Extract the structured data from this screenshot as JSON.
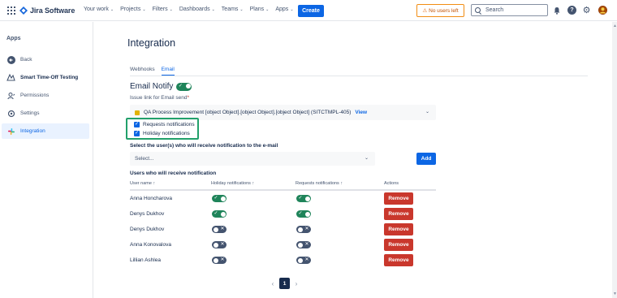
{
  "topnav": {
    "app_name": "Jira Software",
    "items": [
      {
        "label": "Your work"
      },
      {
        "label": "Projects"
      },
      {
        "label": "Filters"
      },
      {
        "label": "Dashboards"
      },
      {
        "label": "Teams"
      },
      {
        "label": "Plans"
      },
      {
        "label": "Apps"
      }
    ],
    "create_label": "Create",
    "warning_label": "No users left",
    "search_placeholder": "Search",
    "help_glyph": "?"
  },
  "sidebar": {
    "title": "Apps",
    "items": [
      {
        "label": "Back",
        "icon": "back-arrow-icon"
      },
      {
        "label": "Smart Time-Off Testing",
        "icon": "app-logo-icon"
      },
      {
        "label": "Permissions",
        "icon": "permissions-icon"
      },
      {
        "label": "Settings",
        "icon": "settings-icon"
      },
      {
        "label": "Integration",
        "icon": "slack-icon"
      }
    ]
  },
  "main": {
    "title": "Integration",
    "tabs": [
      {
        "label": "Webhooks"
      },
      {
        "label": "Email"
      }
    ],
    "email_notify_label": "Email Notify",
    "email_notify_enabled": true,
    "issue_label": "Issue link for Email send",
    "required_mark": "*",
    "issue_value": "QA Process Improvement [object Object].[object Object].[object Object] (SITCTMPL-405)",
    "issue_view_label": "View",
    "checkboxes": [
      {
        "label": "Requests notifications",
        "checked": true
      },
      {
        "label": "Holiday notifications",
        "checked": true
      }
    ],
    "select_users_label": "Select the user(s) who will receive notification to the e-mail",
    "select_placeholder": "Select...",
    "add_label": "Add",
    "users_title": "Users who will receive notification",
    "table": {
      "columns": [
        "User name",
        "Holiday notifications",
        "Requests notifications",
        "Actions"
      ],
      "sort_glyph": "↑",
      "rows": [
        {
          "name": "Anna Honcharova",
          "holiday": true,
          "requests": true,
          "action": "Remove"
        },
        {
          "name": "Denys Dukhov",
          "holiday": true,
          "requests": true,
          "action": "Remove"
        },
        {
          "name": "Denys Dukhov",
          "holiday": false,
          "requests": false,
          "action": "Remove"
        },
        {
          "name": "Anna Konovalova",
          "holiday": false,
          "requests": false,
          "action": "Remove"
        },
        {
          "name": "Lillian Ashlea",
          "holiday": false,
          "requests": false,
          "action": "Remove"
        }
      ]
    },
    "pagination": {
      "current": "1"
    }
  },
  "colors": {
    "brand": "#0c66e4",
    "toggle_on": "#1f845a",
    "toggle_off": "#44546f",
    "danger": "#c9372c",
    "highlight": "#22a06b"
  }
}
